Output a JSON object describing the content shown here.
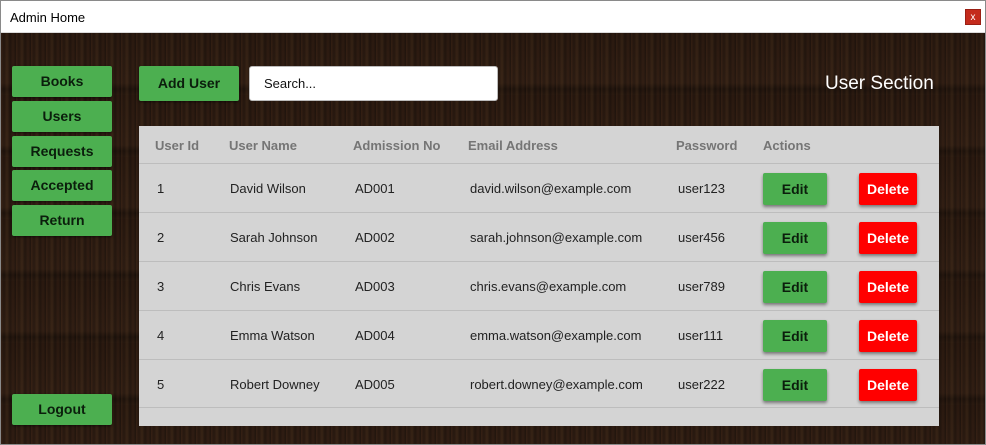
{
  "window": {
    "title": "Admin Home",
    "close_label": "x"
  },
  "sidebar": {
    "items": [
      {
        "label": "Books"
      },
      {
        "label": "Users"
      },
      {
        "label": "Requests"
      },
      {
        "label": "Accepted"
      },
      {
        "label": "Return"
      }
    ],
    "logout_label": "Logout"
  },
  "toolbar": {
    "add_user_label": "Add User",
    "search_placeholder": "Search...",
    "section_title": "User Section"
  },
  "table": {
    "headers": [
      "User Id",
      "User Name",
      "Admission No",
      "Email Address",
      "Password",
      "Actions"
    ],
    "edit_label": "Edit",
    "delete_label": "Delete",
    "rows": [
      {
        "id": "1",
        "name": "David Wilson",
        "admission": "AD001",
        "email": "david.wilson@example.com",
        "password": "user123"
      },
      {
        "id": "2",
        "name": "Sarah Johnson",
        "admission": "AD002",
        "email": "sarah.johnson@example.com",
        "password": "user456"
      },
      {
        "id": "3",
        "name": "Chris Evans",
        "admission": "AD003",
        "email": "chris.evans@example.com",
        "password": "user789"
      },
      {
        "id": "4",
        "name": "Emma Watson",
        "admission": "AD004",
        "email": "emma.watson@example.com",
        "password": "user111"
      },
      {
        "id": "5",
        "name": "Robert Downey",
        "admission": "AD005",
        "email": "robert.downey@example.com",
        "password": "user222"
      }
    ]
  },
  "colors": {
    "primary_green": "#4caf50",
    "delete_red": "#ff0000",
    "table_bg": "#d4d4d4"
  }
}
